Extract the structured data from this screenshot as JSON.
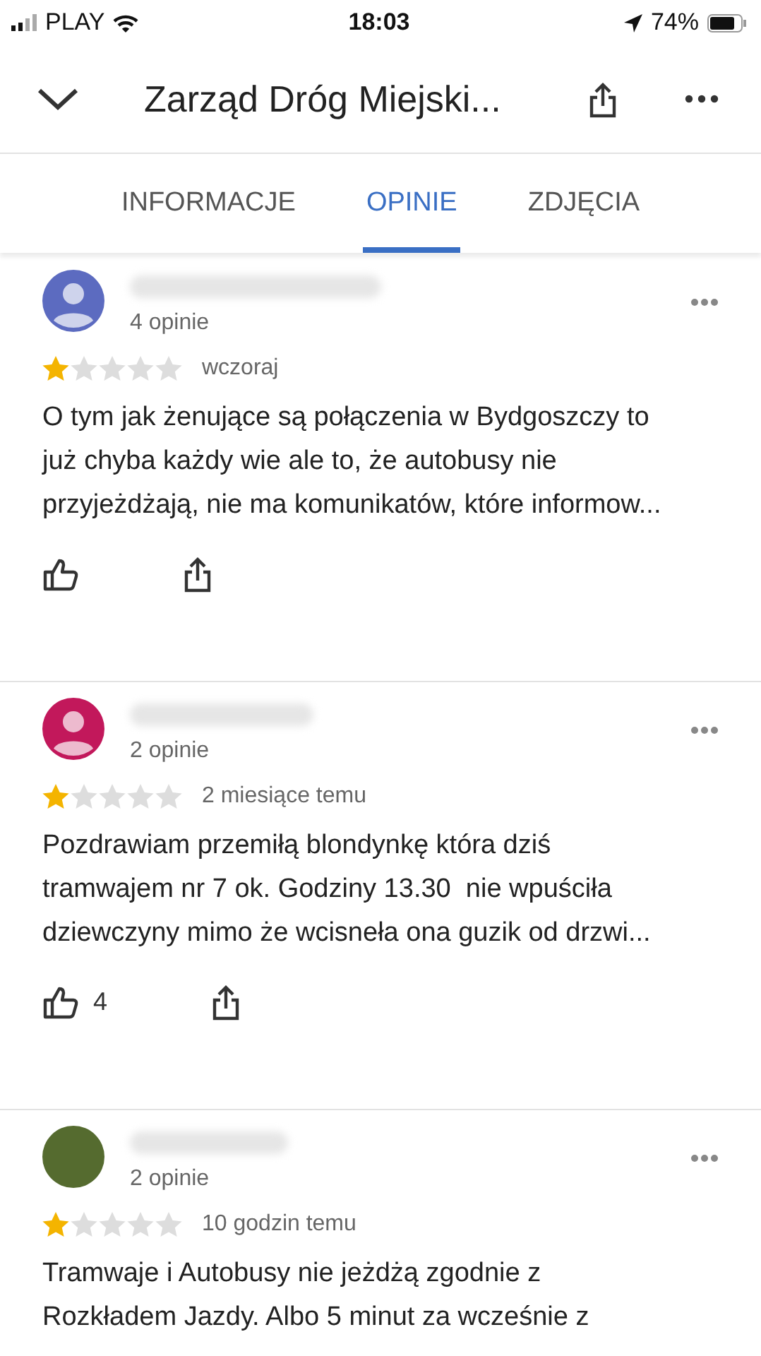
{
  "status_bar": {
    "carrier": "PLAY",
    "time": "18:03",
    "battery": "74%"
  },
  "header": {
    "title": "Zarząd Dróg Miejski..."
  },
  "tabs": [
    {
      "label": "INFORMACJE",
      "selected": false
    },
    {
      "label": "OPINIE",
      "selected": true
    },
    {
      "label": "ZDJĘCIA",
      "selected": false
    }
  ],
  "reviews": [
    {
      "avatar": {
        "kind": "silhouette",
        "color": "#5c6bc0"
      },
      "review_count": "4 opinie",
      "stars": 1,
      "date": "wczoraj",
      "text": "O tym jak żenujące są połączenia w Bydgoszczy to\njuż chyba każdy wie ale to, że autobusy nie\nprzyjeżdżają, nie ma komunikatów, które informow..."
    },
    {
      "avatar": {
        "kind": "silhouette",
        "color": "#c2185b"
      },
      "review_count": "2 opinie",
      "stars": 1,
      "date": "2 miesiące temu",
      "text": "Pozdrawiam przemiłą blondynkę która dziś\ntramwajem nr 7 ok. Godziny 13.30  nie wpuściła\ndziewczyny mimo że wcisneła ona guzik od drzwi...",
      "likes": "4"
    },
    {
      "avatar": {
        "kind": "plain",
        "color": "#556b2f"
      },
      "review_count": "2 opinie",
      "stars": 1,
      "date": "10 godzin temu",
      "text": "Tramwaje i Autobusy nie jeżdżą zgodnie z\nRozkładem Jazdy. Albo 5 minut za wcześnie z"
    }
  ]
}
